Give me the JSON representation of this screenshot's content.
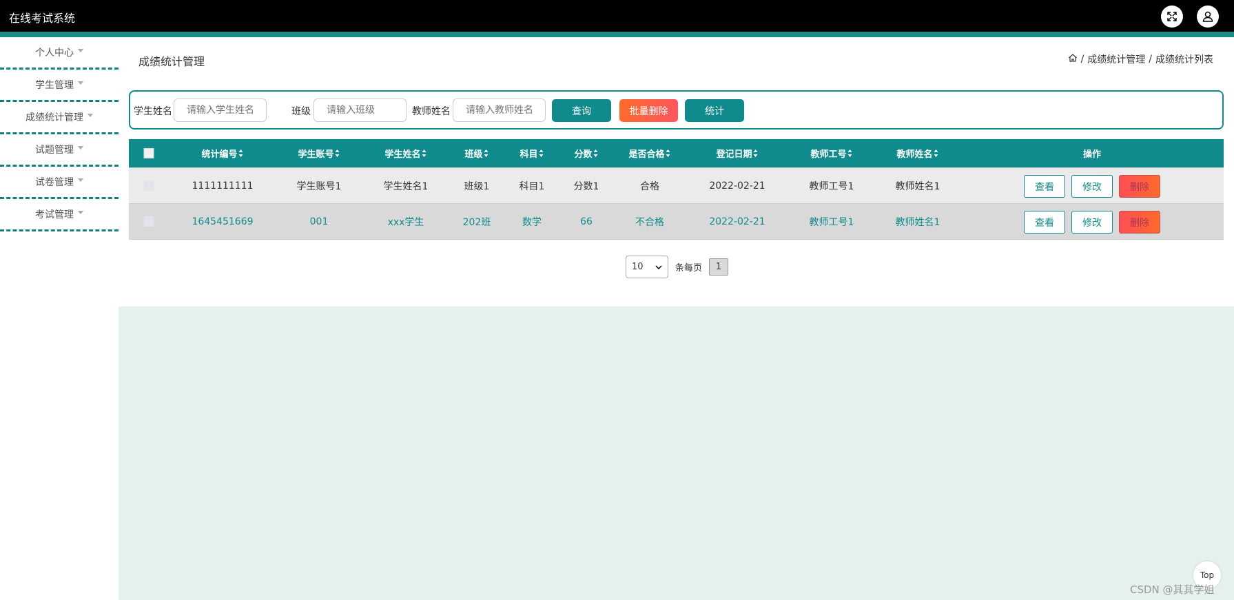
{
  "app": {
    "title": "在线考试系统"
  },
  "sidebar": {
    "items": [
      {
        "label": "个人中心"
      },
      {
        "label": "学生管理"
      },
      {
        "label": "成绩统计管理"
      },
      {
        "label": "试题管理"
      },
      {
        "label": "试卷管理"
      },
      {
        "label": "考试管理"
      }
    ]
  },
  "page": {
    "title": "成绩统计管理",
    "breadcrumb": {
      "sep": "/",
      "level1": "成绩统计管理",
      "level2": "成绩统计列表"
    }
  },
  "search": {
    "student_name_label": "学生姓名",
    "student_name_placeholder": "请输入学生姓名",
    "class_label": "班级",
    "class_placeholder": "请输入班级",
    "teacher_name_label": "教师姓名",
    "teacher_name_placeholder": "请输入教师姓名",
    "query_button": "查询",
    "batch_delete_button": "批量删除",
    "stats_button": "统计"
  },
  "table": {
    "columns": [
      "统计编号",
      "学生账号",
      "学生姓名",
      "班级",
      "科目",
      "分数",
      "是否合格",
      "登记日期",
      "教师工号",
      "教师姓名",
      "操作"
    ],
    "rows": [
      [
        "1111111111",
        "学生账号1",
        "学生姓名1",
        "班级1",
        "科目1",
        "分数1",
        "合格",
        "2022-02-21",
        "教师工号1",
        "教师姓名1"
      ],
      [
        "1645451669",
        "001",
        "xxx学生",
        "202班",
        "数学",
        "66",
        "不合格",
        "2022-02-21",
        "教师工号1",
        "教师姓名1"
      ]
    ],
    "actions": {
      "view": "查看",
      "edit": "修改",
      "delete": "删除"
    }
  },
  "pagination": {
    "page_size": "10",
    "per_page_label": "条每页",
    "current_page": "1"
  },
  "top_button": "Top",
  "watermark": "CSDN @其其学姐",
  "colors": {
    "accent": "#0f8b8d",
    "danger": "#ff5a4a",
    "topbar": "#000000",
    "content_bg": "#e4f1ed"
  }
}
